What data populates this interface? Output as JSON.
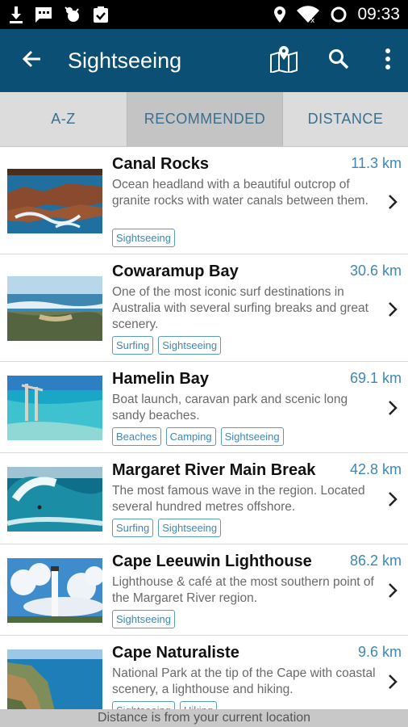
{
  "status_bar": {
    "time": "09:33"
  },
  "app_bar": {
    "title": "Sightseeing"
  },
  "tabs": [
    {
      "label": "A-Z"
    },
    {
      "label": "RECOMMENDED"
    },
    {
      "label": "DISTANCE"
    }
  ],
  "items": [
    {
      "name": "Canal Rocks",
      "distance": "11.3 km",
      "description": "Ocean headland with a beautiful outcrop of granite rocks with water canals between them.",
      "tags": [
        "Sightseeing"
      ]
    },
    {
      "name": "Cowaramup Bay",
      "distance": "30.6 km",
      "description": "One of the most iconic surf destinations in Australia with several surfing breaks and great scenery.",
      "tags": [
        "Surfing",
        "Sightseeing"
      ]
    },
    {
      "name": "Hamelin Bay",
      "distance": "69.1 km",
      "description": "Boat launch, caravan park and scenic long sandy beaches.",
      "tags": [
        "Beaches",
        "Camping",
        "Sightseeing"
      ]
    },
    {
      "name": "Margaret River Main Break",
      "distance": "42.8 km",
      "description": "The most famous wave in the region. Located several hundred metres offshore.",
      "tags": [
        "Surfing",
        "Sightseeing"
      ]
    },
    {
      "name": "Cape Leeuwin Lighthouse",
      "distance": "86.2 km",
      "description": "Lighthouse & café at the most southern point of the Margaret River region.",
      "tags": [
        "Sightseeing"
      ]
    },
    {
      "name": "Cape Naturaliste",
      "distance": "9.6 km",
      "description": "National Park at the tip of the Cape with coastal scenery, a lighthouse and hiking.",
      "tags": [
        "Sightseeing",
        "Hiking"
      ]
    }
  ],
  "footer": {
    "text": "Distance is from your current location"
  },
  "icons": {
    "status_left": [
      "download-icon",
      "message-icon",
      "bug-icon",
      "clipboard-check-icon"
    ],
    "status_right": [
      "location-icon",
      "wifi-icon",
      "circle-icon"
    ],
    "app_bar": [
      "back-arrow-icon",
      "map-icon",
      "search-icon",
      "more-vert-icon"
    ],
    "row": "chevron-right-icon"
  },
  "colors": {
    "app_bar": "#0b4f75",
    "accent": "#3f88b5",
    "tab_selected": "#c4c4c4"
  }
}
